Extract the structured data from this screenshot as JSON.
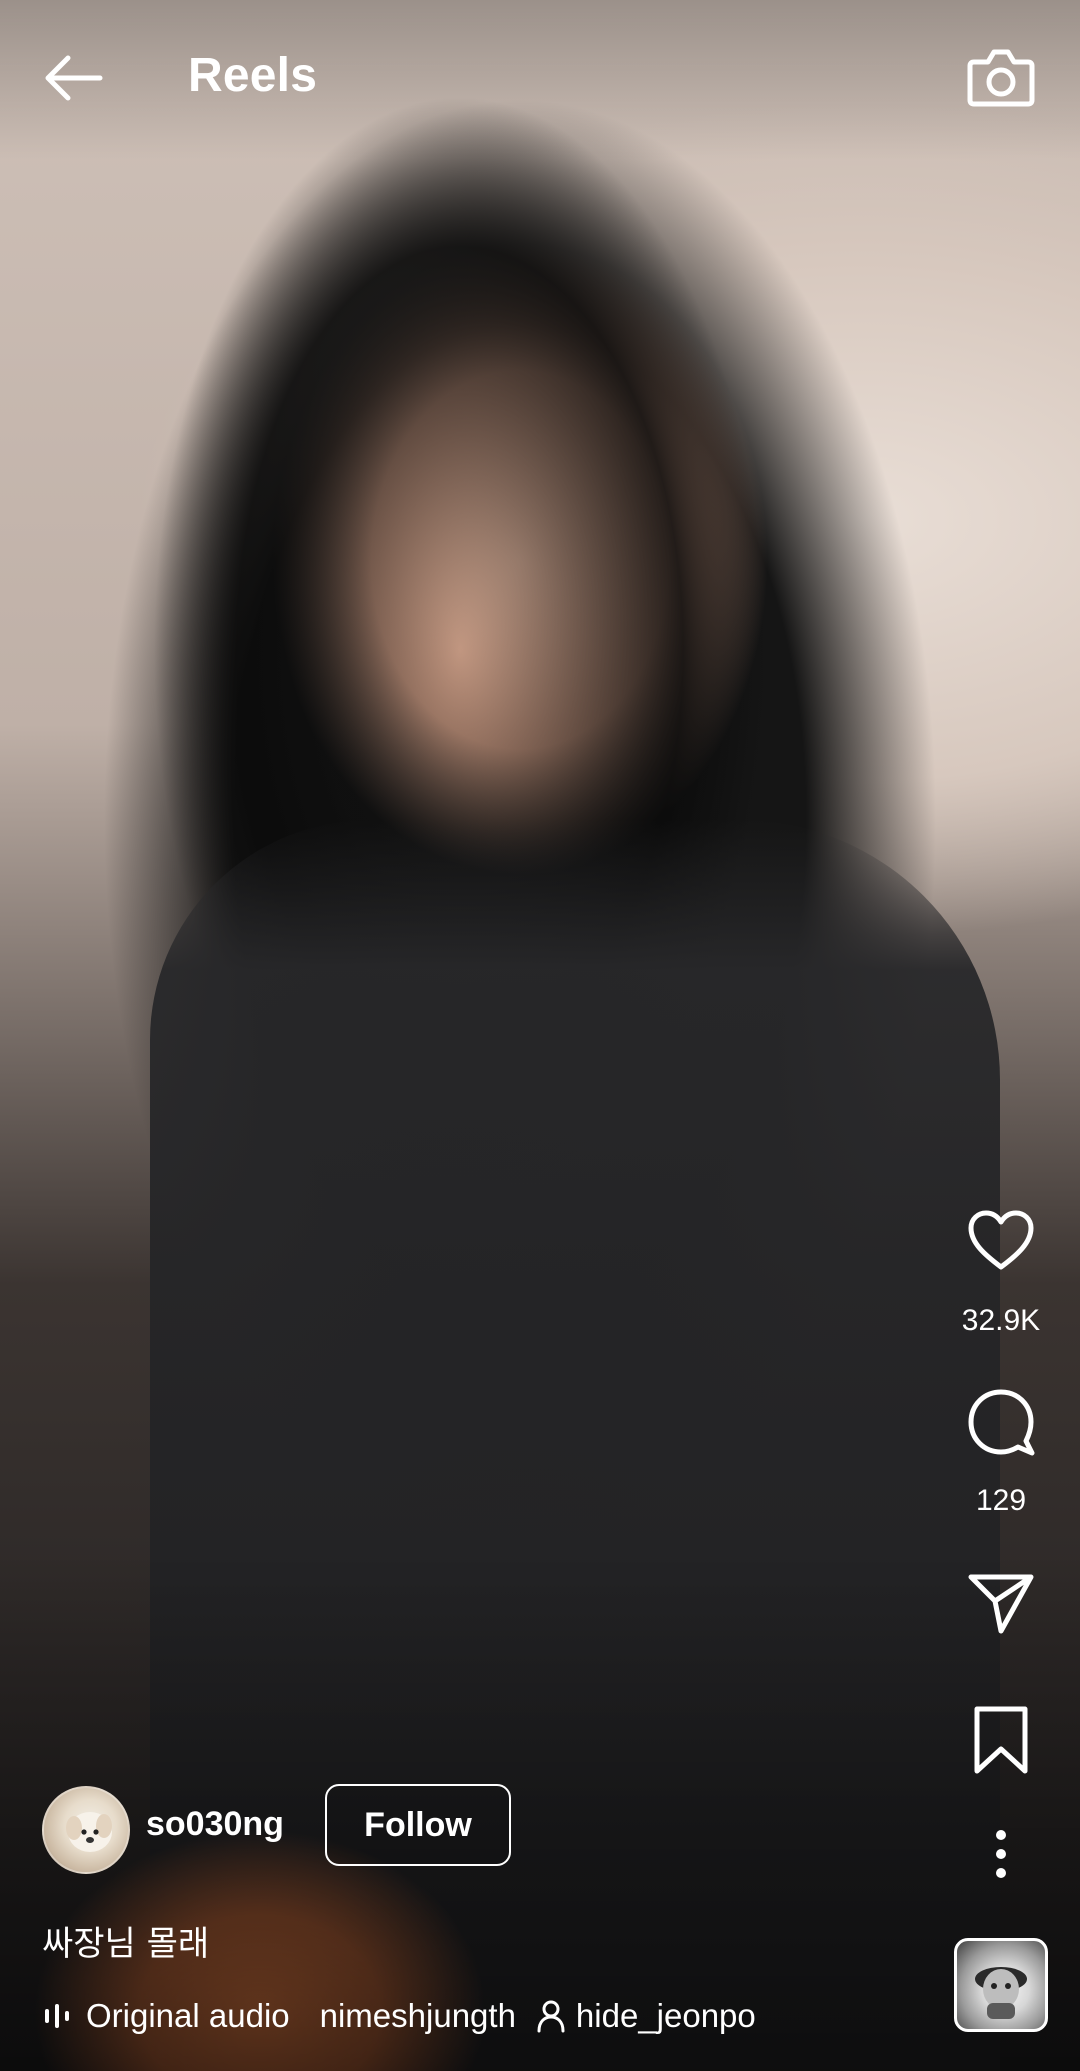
{
  "header": {
    "title": "Reels",
    "back_icon": "arrow-left-icon",
    "camera_icon": "camera-icon"
  },
  "actions": {
    "likes": "32.9K",
    "comments": "129",
    "icons": [
      "heart-icon",
      "comment-icon",
      "send-icon",
      "bookmark-icon",
      "more-vertical-icon"
    ]
  },
  "post": {
    "username": "so030ng",
    "follow_label": "Follow",
    "caption": "싸장님 몰래"
  },
  "audio": {
    "label": "Original audio",
    "artist": "nimeshjungth",
    "tagged_user": "hide_jeonpo"
  },
  "colors": {
    "foreground": "#ffffff"
  }
}
